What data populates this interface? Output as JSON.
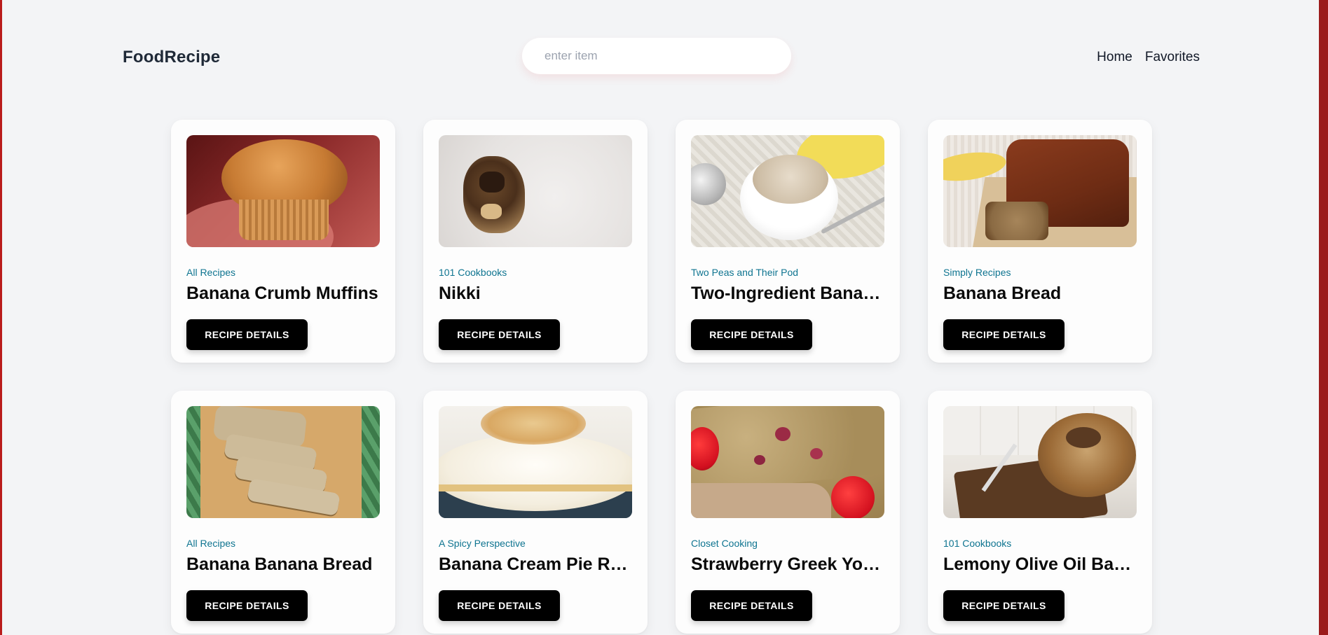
{
  "brand": "FoodRecipe",
  "search": {
    "placeholder": "enter item",
    "value": ""
  },
  "nav": [
    {
      "label": "Home"
    },
    {
      "label": "Favorites"
    }
  ],
  "button_label": "RECIPE DETAILS",
  "recipes": [
    {
      "publisher": "All Recipes",
      "title": "Banana Crumb Muffins"
    },
    {
      "publisher": "101 Cookbooks",
      "title": "Nikki"
    },
    {
      "publisher": "Two Peas and Their Pod",
      "title": "Two-Ingredient Banan..."
    },
    {
      "publisher": "Simply Recipes",
      "title": "Banana Bread"
    },
    {
      "publisher": "All Recipes",
      "title": "Banana Banana Bread"
    },
    {
      "publisher": "A Spicy Perspective",
      "title": "Banana Cream Pie Rec..."
    },
    {
      "publisher": "Closet Cooking",
      "title": "Strawberry Greek Yog..."
    },
    {
      "publisher": "101 Cookbooks",
      "title": "Lemony Olive Oil Ban..."
    }
  ],
  "colors": {
    "page_bg": "#f3f4f6",
    "publisher": "#0e7490",
    "button_bg": "#000000",
    "accent_edge": "#b91c1c"
  }
}
